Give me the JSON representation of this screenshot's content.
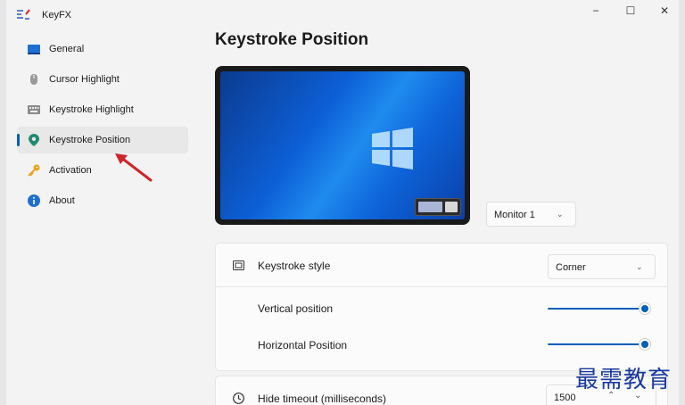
{
  "app": {
    "title": "KeyFX",
    "logo_icon": "keyfx-logo-icon"
  },
  "window_controls": {
    "minimize": "−",
    "maximize": "☐",
    "close": "✕"
  },
  "sidebar": {
    "selected_index": 3,
    "items": [
      {
        "label": "General",
        "icon": "monitor-icon"
      },
      {
        "label": "Cursor Highlight",
        "icon": "mouse-icon"
      },
      {
        "label": "Keystroke Highlight",
        "icon": "keyboard-icon"
      },
      {
        "label": "Keystroke Position",
        "icon": "location-pin-icon"
      },
      {
        "label": "Activation",
        "icon": "key-icon"
      },
      {
        "label": "About",
        "icon": "info-icon"
      }
    ]
  },
  "main": {
    "title": "Keystroke Position",
    "monitor_select": {
      "value": "Monitor 1"
    },
    "settings": {
      "keystroke_style": {
        "label": "Keystroke style",
        "value": "Corner"
      },
      "vertical_position": {
        "label": "Vertical position",
        "value_fraction": 0.92
      },
      "horizontal_position": {
        "label": "Horizontal Position",
        "value_fraction": 0.92
      },
      "hide_timeout": {
        "label": "Hide timeout (milliseconds)",
        "value": "1500"
      }
    }
  },
  "watermark": "最需教育",
  "colors": {
    "accent": "#005fb8",
    "arrow": "#d0242b",
    "background": "#f3f3f3"
  }
}
